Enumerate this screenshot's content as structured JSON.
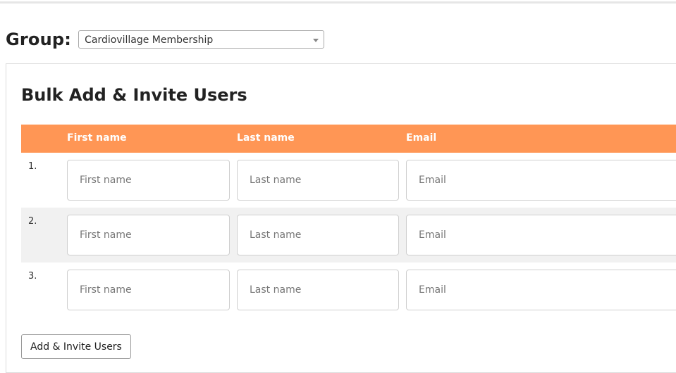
{
  "group": {
    "label": "Group:",
    "selected": "Cardiovillage Membership"
  },
  "panel": {
    "title": "Bulk Add & Invite Users",
    "columns": {
      "first_name": "First name",
      "last_name": "Last name",
      "email": "Email"
    },
    "rows": [
      {
        "number": "1.",
        "first_placeholder": "First name",
        "last_placeholder": "Last name",
        "email_placeholder": "Email"
      },
      {
        "number": "2.",
        "first_placeholder": "First name",
        "last_placeholder": "Last name",
        "email_placeholder": "Email"
      },
      {
        "number": "3.",
        "first_placeholder": "First name",
        "last_placeholder": "Last name",
        "email_placeholder": "Email"
      }
    ],
    "submit_label": "Add & Invite Users"
  },
  "colors": {
    "header_accent": "#ff9655",
    "alt_row": "#f1f1f1"
  },
  "icons": {
    "select_caret": "chevron-down-icon"
  }
}
